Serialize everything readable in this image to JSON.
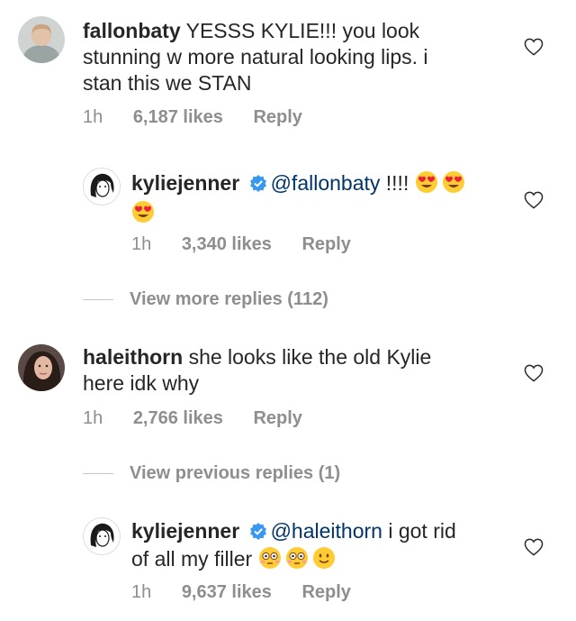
{
  "comments": [
    {
      "username": "fallonbaty",
      "text_line1": "YESSS KYLIE!!! you look",
      "text_line2": "stunning w more natural looking lips. i",
      "text_line3": "stan this we STAN",
      "time": "1h",
      "likes": "6,187 likes",
      "reply": "Reply"
    },
    {
      "username": "kyliejenner",
      "mention": "@fallonbaty",
      "text": " !!!!",
      "emojis": [
        "heart-eyes-emoji",
        "heart-eyes-emoji",
        "heart-eyes-emoji"
      ],
      "time": "1h",
      "likes": "3,340 likes",
      "reply": "Reply"
    },
    {
      "view_more": "View more replies (112)"
    },
    {
      "username": "haleithorn",
      "text_line1": "she looks like the old Kylie",
      "text_line2": "here idk why",
      "time": "1h",
      "likes": "2,766 likes",
      "reply": "Reply"
    },
    {
      "view_previous": "View previous replies (1)"
    },
    {
      "username": "kyliejenner",
      "mention": "@haleithorn",
      "text_line1": " i got rid",
      "text_line2": "of all my filler",
      "emojis": [
        "flushed-emoji",
        "flushed-emoji",
        "slight-smile-emoji"
      ],
      "time": "1h",
      "likes": "9,637 likes",
      "reply": "Reply"
    }
  ],
  "colors": {
    "text": "#262626",
    "meta": "#8e8e8e",
    "mention": "#003569",
    "verified": "#3897f0"
  }
}
